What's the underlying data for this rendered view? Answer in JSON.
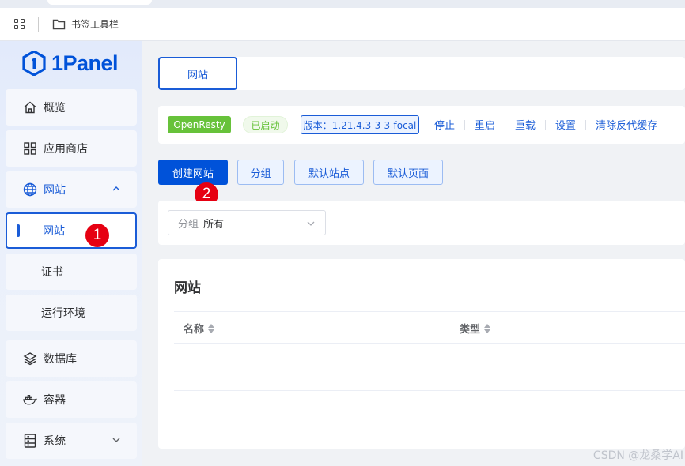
{
  "bookmarks_bar": {
    "apps_icon": "grid-icon",
    "folder_icon": "folder-icon",
    "folder_label": "书签工具栏"
  },
  "sidebar": {
    "logo_text": "1Panel",
    "items": [
      {
        "label": "概览",
        "icon": "home-icon"
      },
      {
        "label": "应用商店",
        "icon": "apps-icon"
      },
      {
        "label": "网站",
        "icon": "globe-icon",
        "expanded": true,
        "children": [
          {
            "label": "网站",
            "active": true
          },
          {
            "label": "证书"
          },
          {
            "label": "运行环境"
          }
        ]
      },
      {
        "label": "数据库",
        "icon": "layers-icon"
      },
      {
        "label": "容器",
        "icon": "docker-icon"
      },
      {
        "label": "系统",
        "icon": "server-icon",
        "expanded": false
      }
    ]
  },
  "callouts": [
    "1",
    "2"
  ],
  "tabs": [
    {
      "label": "网站",
      "active": true
    }
  ],
  "status_bar": {
    "app_tag": "OpenResty",
    "state_tag": "已启动",
    "version_tag": "版本：1.21.4.3-3-3-focal",
    "actions": [
      "停止",
      "重启",
      "重载",
      "设置",
      "清除反代缓存"
    ]
  },
  "toolbar": {
    "create": "创建网站",
    "group": "分组",
    "default_site": "默认站点",
    "default_page": "默认页面"
  },
  "filter": {
    "prefix": "分组",
    "value": "所有"
  },
  "table": {
    "title": "网站",
    "columns": [
      "名称",
      "类型"
    ]
  },
  "watermark": "CSDN @龙桑学AI",
  "colors": {
    "primary": "#0052d9",
    "success": "#67c23a",
    "callout": "#e60012"
  }
}
